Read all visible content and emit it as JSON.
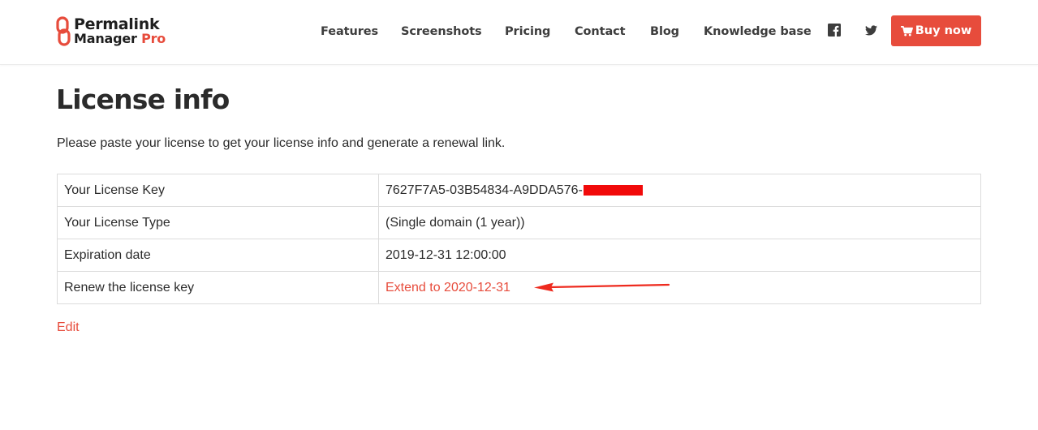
{
  "brand": {
    "line1": "Permalink",
    "line2": "Manager",
    "line2_pro": "Pro",
    "accent_color": "#e74c3c"
  },
  "nav": {
    "items": [
      "Features",
      "Screenshots",
      "Pricing",
      "Contact",
      "Blog",
      "Knowledge base"
    ],
    "social": [
      "facebook-icon",
      "twitter-icon"
    ],
    "buy_label": "Buy now",
    "buy_icon": "shopping-cart-icon"
  },
  "main": {
    "title": "License info",
    "intro": "Please paste your license to get your license info and generate a renewal link.",
    "rows": [
      {
        "label": "Your License Key",
        "value": "7627F7A5-03B54834-A9DDA576-"
      },
      {
        "label": "Your License Type",
        "value": "(Single domain (1 year))"
      },
      {
        "label": "Expiration date",
        "value": "2019-12-31 12:00:00"
      },
      {
        "label": "Renew the license key",
        "value": "Extend to 2020-12-31"
      }
    ],
    "edit_label": "Edit"
  }
}
